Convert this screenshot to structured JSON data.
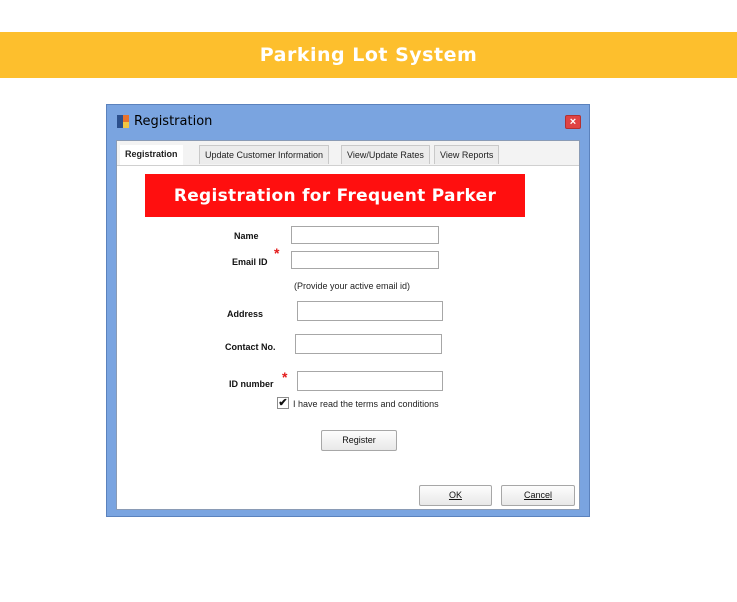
{
  "banner": {
    "title": "Parking Lot System"
  },
  "window": {
    "title": "Registration",
    "close_glyph": "×",
    "tabs": [
      {
        "label": "Registration",
        "active": true
      },
      {
        "label": "Update Customer Information",
        "active": false
      },
      {
        "label": "View/Update Rates",
        "active": false
      },
      {
        "label": "View Reports",
        "active": false
      }
    ]
  },
  "form": {
    "header": "Registration for Frequent Parker",
    "name_label": "Name",
    "name_value": "",
    "email_label": "Email ID",
    "email_value": "",
    "email_hint": "(Provide your active email id)",
    "address_label": "Address",
    "address_value": "",
    "contact_label": "Contact No.",
    "contact_value": "",
    "id_label": "ID number",
    "id_value": "",
    "required_mark": "*",
    "terms_checked": true,
    "terms_label": "I have read the terms and conditions",
    "register_label": "Register"
  },
  "footer": {
    "ok_label": "OK",
    "cancel_label": "Cancel"
  },
  "colors": {
    "banner": "#fdbf2d",
    "window_frame": "#7aa4e0",
    "header_bar": "#ff0f0f",
    "required": "#e31b1b"
  },
  "icons": {
    "app": "app-window-icon",
    "close": "close-icon",
    "check": "checkmark-icon"
  }
}
